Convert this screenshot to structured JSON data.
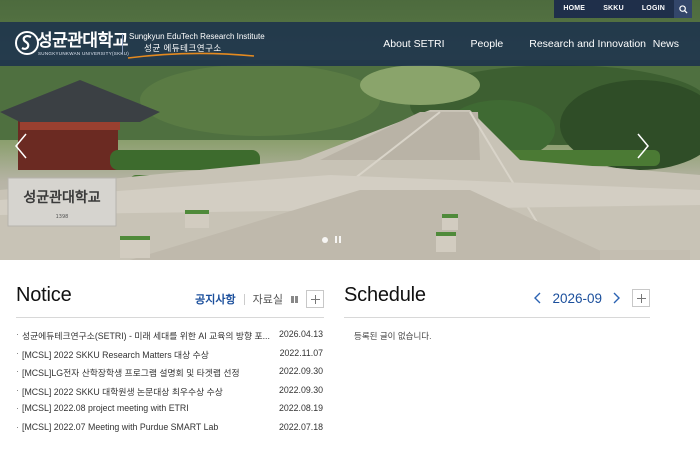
{
  "utility_nav": {
    "home": "HOME",
    "skku": "SKKU",
    "login": "LOGIN"
  },
  "logo": {
    "university_ko": "성균관대학교",
    "university_en": "SUNGKYUNKWAN UNIVERSITY(SKKU)",
    "institute_en": "Sungkyun EduTech Research Institute",
    "institute_ko": "성균 에듀테크연구소"
  },
  "main_menu": [
    "About SETRI",
    "People",
    "Research and Innovation",
    "News"
  ],
  "hero": {
    "stone_sign": "성균관대학교",
    "stone_year": "1398"
  },
  "notice": {
    "title": "Notice",
    "tab_active": "공지사항",
    "tab_inactive": "자료실",
    "items": [
      {
        "title": "성균에듀테크연구소(SETRI) - 미래 세대를 위한 AI 교육의 방향 포...",
        "date": "2026.04.13"
      },
      {
        "title": "[MCSL] 2022 SKKU Research Matters 대상 수상",
        "date": "2022.11.07"
      },
      {
        "title": "[MCSL]LG전자 산학장학생 프로그램 설명회 및 타겟랩 선정",
        "date": "2022.09.30"
      },
      {
        "title": "[MCSL] 2022 SKKU 대학원생 논문대상 최우수상 수상",
        "date": "2022.09.30"
      },
      {
        "title": "[MCSL] 2022.08 project meeting with ETRI",
        "date": "2022.08.19"
      },
      {
        "title": "[MCSL] 2022.07 Meeting with Purdue SMART Lab",
        "date": "2022.07.18"
      }
    ]
  },
  "schedule": {
    "title": "Schedule",
    "month": "2026-09",
    "empty_text": "등록된 글이 없습니다."
  },
  "colors": {
    "nav_bg": "#162a4e",
    "accent": "#1b4f9c"
  }
}
